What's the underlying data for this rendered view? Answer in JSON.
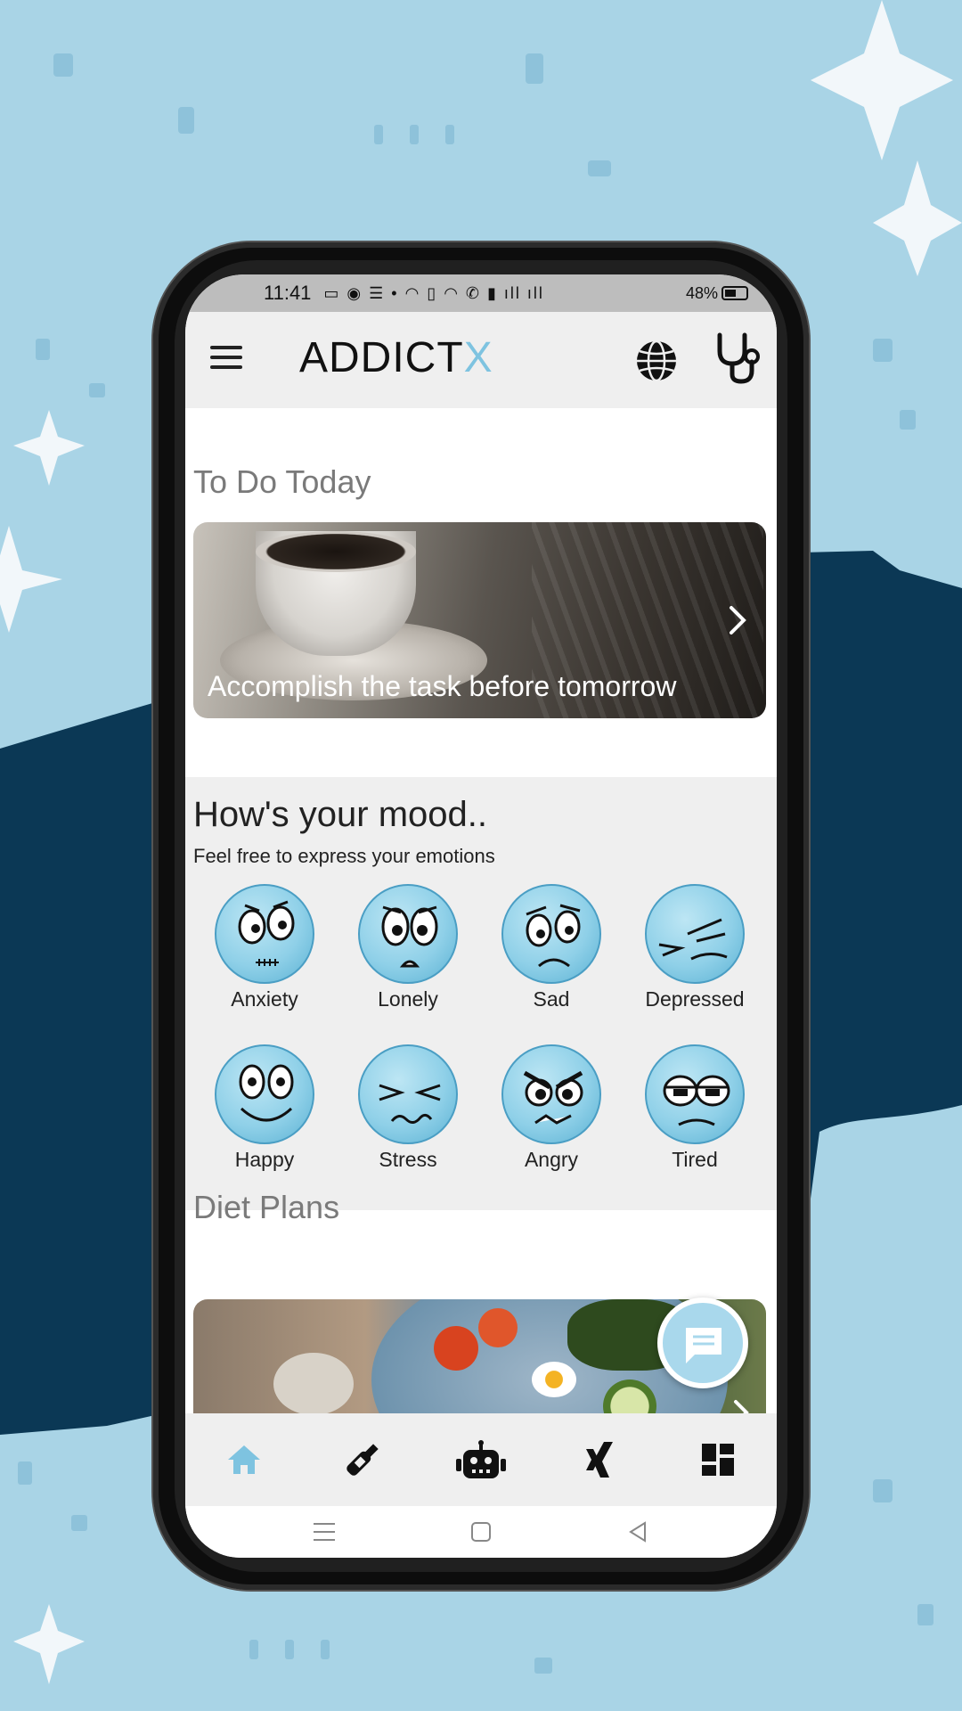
{
  "statusbar": {
    "time": "11:41",
    "battery": "48%"
  },
  "appbar": {
    "brand_main": "ADDICT",
    "brand_accent": "X"
  },
  "todo": {
    "title": "To Do Today",
    "card_caption": "Accomplish the task  before tomorrow"
  },
  "mood": {
    "title": "How's your mood..",
    "subtitle": "Feel free to express your emotions",
    "items": [
      {
        "label": "Anxiety"
      },
      {
        "label": "Lonely"
      },
      {
        "label": "Sad"
      },
      {
        "label": "Depressed"
      },
      {
        "label": "Happy"
      },
      {
        "label": "Stress"
      },
      {
        "label": "Angry"
      },
      {
        "label": "Tired"
      }
    ]
  },
  "diet": {
    "title": "Diet Plans"
  },
  "bottom_nav": [
    "home-icon",
    "bottle-icon",
    "robot-icon",
    "xing-icon",
    "dashboard-icon"
  ],
  "colors": {
    "accent": "#7ec3e0",
    "background": "#a9d4e6",
    "band": "#0b3855"
  }
}
